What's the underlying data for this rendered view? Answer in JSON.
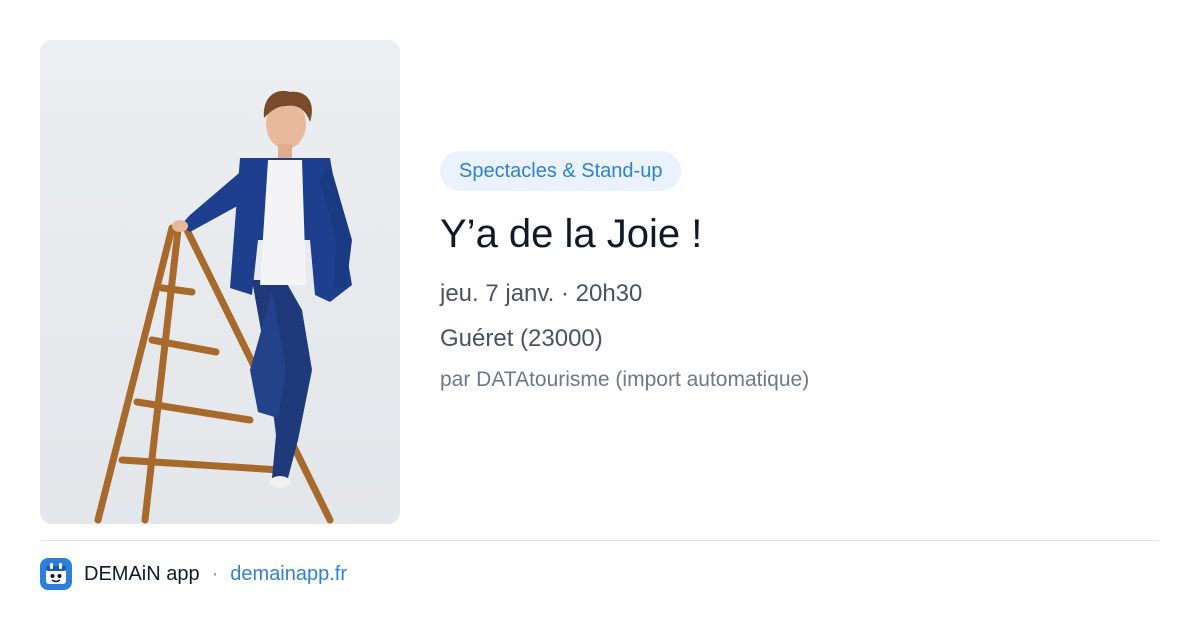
{
  "event": {
    "category": "Spectacles & Stand-up",
    "title": "Y’a de la Joie !",
    "datetime": "jeu. 7 janv. · 20h30",
    "location": "Guéret (23000)",
    "source": "par DATAtourisme (import automatique)",
    "image_alt": "Performer in blue suit leaning on a wooden stepladder"
  },
  "footer": {
    "icon": "app-logo-icon",
    "app_name": "DEMAiN app",
    "separator": "·",
    "site": "demainapp.fr"
  },
  "colors": {
    "accent": "#2f7fd8",
    "tag_bg": "#eaf3fd",
    "title": "#10182a",
    "meta": "#4a5262",
    "muted": "#6f7888",
    "divider": "#dce3ec"
  }
}
